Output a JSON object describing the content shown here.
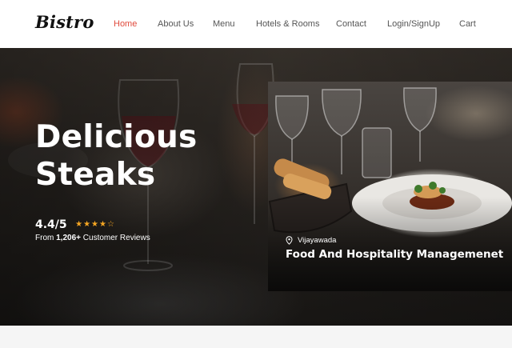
{
  "header": {
    "logo": "Bistro",
    "nav": [
      {
        "label": "Home",
        "active": true
      },
      {
        "label": "About Us",
        "active": false
      },
      {
        "label": "Menu",
        "active": false
      },
      {
        "label": "Hotels & Rooms",
        "active": false
      },
      {
        "label": "Contact",
        "active": false
      },
      {
        "label": "Login/SignUp",
        "active": false
      },
      {
        "label": "Cart",
        "active": false
      }
    ]
  },
  "hero": {
    "title_line1": "Delicious",
    "title_line2": "Steaks",
    "rating": "4.4/5",
    "stars": {
      "filled": 4,
      "total": 5
    },
    "reviews_prefix": "From",
    "reviews_count": "1,206+",
    "reviews_suffix": "Customer Reviews"
  },
  "feature_card": {
    "location": "Vijayawada",
    "title": "Food And Hospitality Managemenet"
  },
  "colors": {
    "accent": "#e04a3c",
    "star": "#f5a623",
    "nav_text": "#555555"
  },
  "icons": {
    "location": "map-pin-icon",
    "star": "star-icon"
  }
}
